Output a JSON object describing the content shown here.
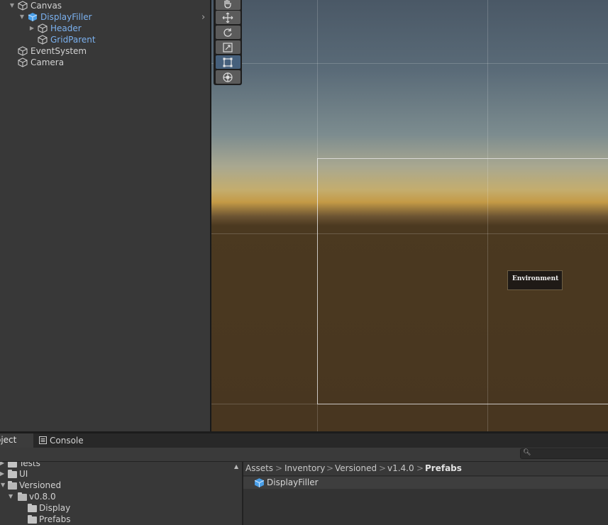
{
  "hierarchy": {
    "items": [
      {
        "label": "Canvas",
        "kind": "plain",
        "expanded": true
      },
      {
        "label": "DisplayFiller",
        "kind": "prefab",
        "expanded": true
      },
      {
        "label": "Header",
        "kind": "prefab",
        "expanded": false
      },
      {
        "label": "GridParent",
        "kind": "prefab"
      },
      {
        "label": "EventSystem",
        "kind": "plain"
      },
      {
        "label": "Camera",
        "kind": "plain"
      }
    ]
  },
  "scene": {
    "tools": [
      "hand-tool",
      "move-tool",
      "rotate-tool",
      "scale-tool",
      "rect-tool",
      "transform-tool"
    ],
    "active_tool": "rect-tool",
    "world_label": "Environment"
  },
  "tabs": {
    "project": "oject",
    "console": "Console"
  },
  "project_tree": {
    "items": [
      {
        "label": "Tests"
      },
      {
        "label": "UI"
      },
      {
        "label": "Versioned"
      },
      {
        "label": "v0.8.0"
      },
      {
        "label": "Display"
      },
      {
        "label": "Prefabs"
      }
    ]
  },
  "breadcrumb": [
    "Assets",
    "Inventory",
    "Versioned",
    "v1.4.0",
    "Prefabs"
  ],
  "breadcrumb_separator": ">",
  "files": [
    {
      "label": "DisplayFiller"
    }
  ],
  "colors": {
    "prefab_text": "#7bb1ef",
    "active_tool": "#46607c",
    "panel_bg": "#383838"
  }
}
